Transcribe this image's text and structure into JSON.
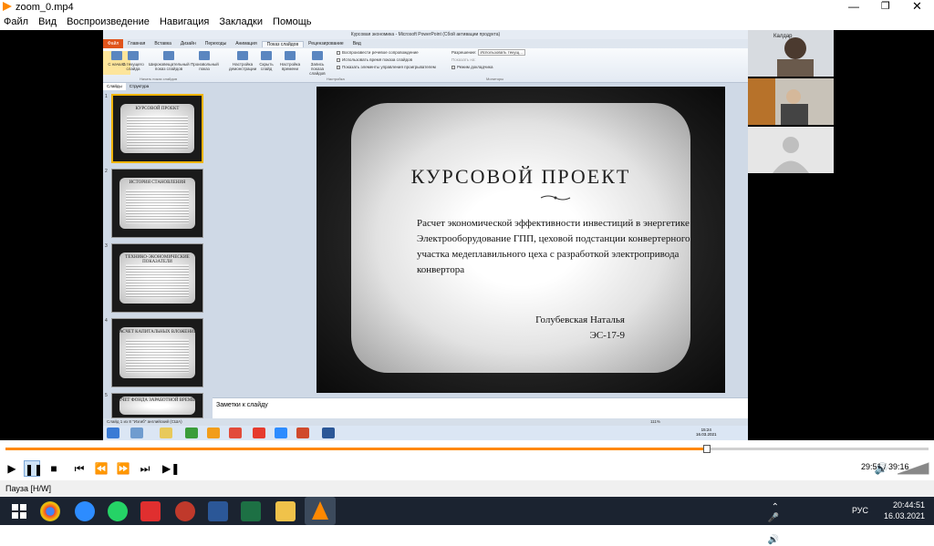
{
  "window": {
    "title": "zoom_0.mp4"
  },
  "menu": [
    "Файл",
    "Вид",
    "Воспроизведение",
    "Навигация",
    "Закладки",
    "Помощь"
  ],
  "ppt": {
    "title": "Курсовая экономика - Microsoft PowerPoint (Сбой активации продукта)",
    "tabs": [
      "Файл",
      "Главная",
      "Вставка",
      "Дизайн",
      "Переходы",
      "Анимация",
      "Показ слайдов",
      "Рецензирование",
      "Вид"
    ],
    "ribbon": {
      "buttons": [
        "С начала",
        "С текущего слайда",
        "Широковещательный показ слайдов",
        "Произвольный показ",
        "Настройка демонстрации",
        "Скрыть слайд",
        "Настройка времени",
        "Запись показа слайдов"
      ],
      "checks": [
        "Воспроизвести речевое сопровождение",
        "Использовать время показа слайдов",
        "Показать элементы управления проигрывателем"
      ],
      "resolution_label": "Разрешение:",
      "resolution_value": "Использовать текущ...",
      "show_on_label": "Показать на:",
      "presenter_view": "Режим докладчика",
      "groups": [
        "Начать показ слайдов",
        "Настройка",
        "Мониторы"
      ]
    },
    "pane_tabs": [
      "Слайды",
      "Структура"
    ],
    "thumbnails": [
      {
        "num": "1",
        "title": "КУРСОВОЙ ПРОЕКТ"
      },
      {
        "num": "2",
        "title": "ИСТОРИЯ СТАНОВЛЕНИЯ"
      },
      {
        "num": "3",
        "title": "ТЕХНИКО-ЭКОНОМИЧЕСКИЕ ПОКАЗАТЕЛИ"
      },
      {
        "num": "4",
        "title": "РАСЧЕТ КАПИТАЛЬНЫХ ВЛОЖЕНИЙ"
      },
      {
        "num": "5",
        "title": "РАСЧЕТ ФОНДА ЗАРАБОТНОЙ ВРЕМЕНИ"
      }
    ],
    "slide": {
      "title": "КУРСОВОЙ ПРОЕКТ",
      "body": "Расчет экономической эффективности инвестиций в энергетике Электрооборудование ГПП, цеховой подстанции конвертерного участка медеплавильного цеха с разработкой электропривода конвертора",
      "author": "Голубевская Наталья",
      "group": "ЭС-17-9"
    },
    "notes_placeholder": "Заметки к слайду",
    "status": "Слайд 1 из 8    \"Изгиб\"    английский (США)",
    "zoom": "111%",
    "inner_clock": "15:24",
    "inner_date": "16.03.2021"
  },
  "participants": [
    {
      "name": "Калдар"
    },
    {
      "name": ""
    },
    {
      "name": ""
    }
  ],
  "player": {
    "time": "29:51 / 39:16",
    "progress": 0.76,
    "state": "Пауза [H/W]"
  },
  "tray": {
    "lang": "РУС",
    "time": "20:44:51",
    "date": "16.03.2021"
  },
  "colors": {
    "accent": "#e0541c",
    "taskbar": "#1b2330"
  }
}
